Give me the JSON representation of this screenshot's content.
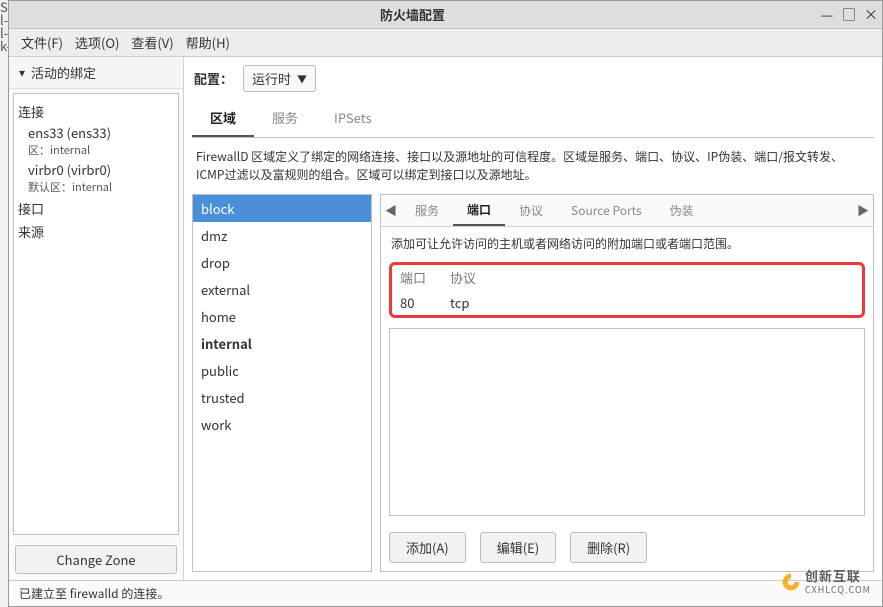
{
  "gutter": [
    "S)",
    "l-",
    "l-",
    "",
    "k-"
  ],
  "titlebar": {
    "title": "防火墙配置",
    "min": "—",
    "max": "□",
    "close": "×"
  },
  "menubar": {
    "file": "文件(F)",
    "options": "选项(O)",
    "view": "查看(V)",
    "help": "帮助(H)"
  },
  "sidebar": {
    "header": "活动的绑定",
    "chevron": "▾",
    "categories": [
      {
        "label": "连接",
        "items": [
          {
            "name": "ens33 (ens33)",
            "sub": "区：internal"
          },
          {
            "name": "virbr0 (virbr0)",
            "sub": "默认区：internal"
          }
        ]
      },
      {
        "label": "接口",
        "items": []
      },
      {
        "label": "来源",
        "items": []
      }
    ],
    "change_zone": "Change Zone"
  },
  "config": {
    "label": "配置：",
    "value": "运行时"
  },
  "tabs": {
    "zones": "区域",
    "services": "服务",
    "ipsets": "IPSets"
  },
  "zone_desc": "FirewallD 区域定义了绑定的网络连接、接口以及源地址的可信程度。区域是服务、端口、协议、IP伪装、端口/报文转发、ICMP过滤以及富规则的组合。区域可以绑定到接口以及源地址。",
  "zones": [
    "block",
    "dmz",
    "drop",
    "external",
    "home",
    "internal",
    "public",
    "trusted",
    "work"
  ],
  "zone_bold": "internal",
  "zone_selected": "block",
  "subtabs": {
    "scroll_left": "◀",
    "scroll_right": "▶",
    "services": "服务",
    "ports": "端口",
    "protocols": "协议",
    "source_ports": "Source Ports",
    "masquerade": "伪装"
  },
  "detail_desc": "添加可让允许访问的主机或者网络访问的附加端口或者端口范围。",
  "port_table": {
    "col_port": "端口",
    "col_proto": "协议",
    "rows": [
      {
        "port": "80",
        "proto": "tcp"
      }
    ]
  },
  "buttons": {
    "add": "添加(A)",
    "edit": "编辑(E)",
    "delete": "删除(R)"
  },
  "status": "已建立至 firewalld 的连接。",
  "watermark": {
    "brand": "创新互联",
    "sub": "CXHLCQ.COM"
  }
}
